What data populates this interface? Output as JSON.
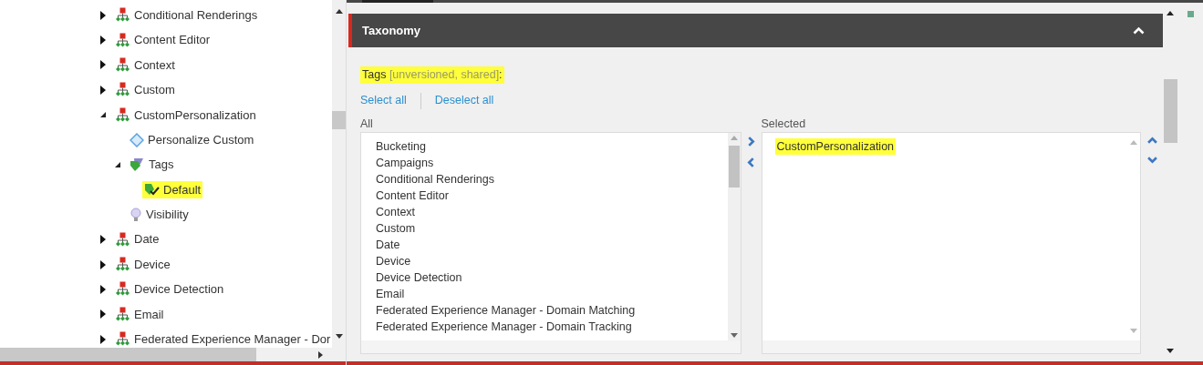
{
  "tree": {
    "items": [
      {
        "label": "Conditional Renderings",
        "kind": "folder",
        "expanded": false,
        "highlighted": false
      },
      {
        "label": "Content Editor",
        "kind": "folder",
        "expanded": false,
        "highlighted": false
      },
      {
        "label": "Context",
        "kind": "folder",
        "expanded": false,
        "highlighted": false
      },
      {
        "label": "Custom",
        "kind": "folder",
        "expanded": false,
        "highlighted": false
      },
      {
        "label": "CustomPersonalization",
        "kind": "folder",
        "expanded": true,
        "highlighted": false,
        "children": [
          {
            "label": "Personalize Custom",
            "kind": "rule",
            "highlighted": false
          },
          {
            "label": "Tags",
            "kind": "tags",
            "expanded": true,
            "highlighted": false,
            "children": [
              {
                "label": "Default",
                "kind": "tag",
                "highlighted": true
              }
            ]
          },
          {
            "label": "Visibility",
            "kind": "bulb",
            "highlighted": false
          }
        ]
      },
      {
        "label": "Date",
        "kind": "folder",
        "expanded": false,
        "highlighted": false
      },
      {
        "label": "Device",
        "kind": "folder",
        "expanded": false,
        "highlighted": false
      },
      {
        "label": "Device Detection",
        "kind": "folder",
        "expanded": false,
        "highlighted": false
      },
      {
        "label": "Email",
        "kind": "folder",
        "expanded": false,
        "highlighted": false
      },
      {
        "label": "Federated Experience Manager - Dor",
        "kind": "folder",
        "expanded": false,
        "highlighted": false
      }
    ]
  },
  "section": {
    "title": "Taxonomy",
    "expanded": true,
    "field": {
      "label": "Tags",
      "note": "[unversioned, shared]",
      "suffix": ":",
      "highlighted": true
    },
    "actions": [
      "Select all",
      "Deselect all"
    ],
    "all": {
      "label": "All",
      "items": [
        {
          "label": "Bucketing",
          "highlighted": false
        },
        {
          "label": "Campaigns",
          "highlighted": false
        },
        {
          "label": "Conditional Renderings",
          "highlighted": false
        },
        {
          "label": "Content Editor",
          "highlighted": false
        },
        {
          "label": "Context",
          "highlighted": false
        },
        {
          "label": "Custom",
          "highlighted": false
        },
        {
          "label": "Date",
          "highlighted": false
        },
        {
          "label": "Device",
          "highlighted": false
        },
        {
          "label": "Device Detection",
          "highlighted": false
        },
        {
          "label": "Email",
          "highlighted": false
        },
        {
          "label": "Federated Experience Manager - Domain Matching",
          "highlighted": false
        },
        {
          "label": "Federated Experience Manager - Domain Tracking",
          "highlighted": false
        }
      ]
    },
    "selected": {
      "label": "Selected",
      "items": [
        {
          "label": "CustomPersonalization",
          "highlighted": true
        }
      ]
    }
  }
}
